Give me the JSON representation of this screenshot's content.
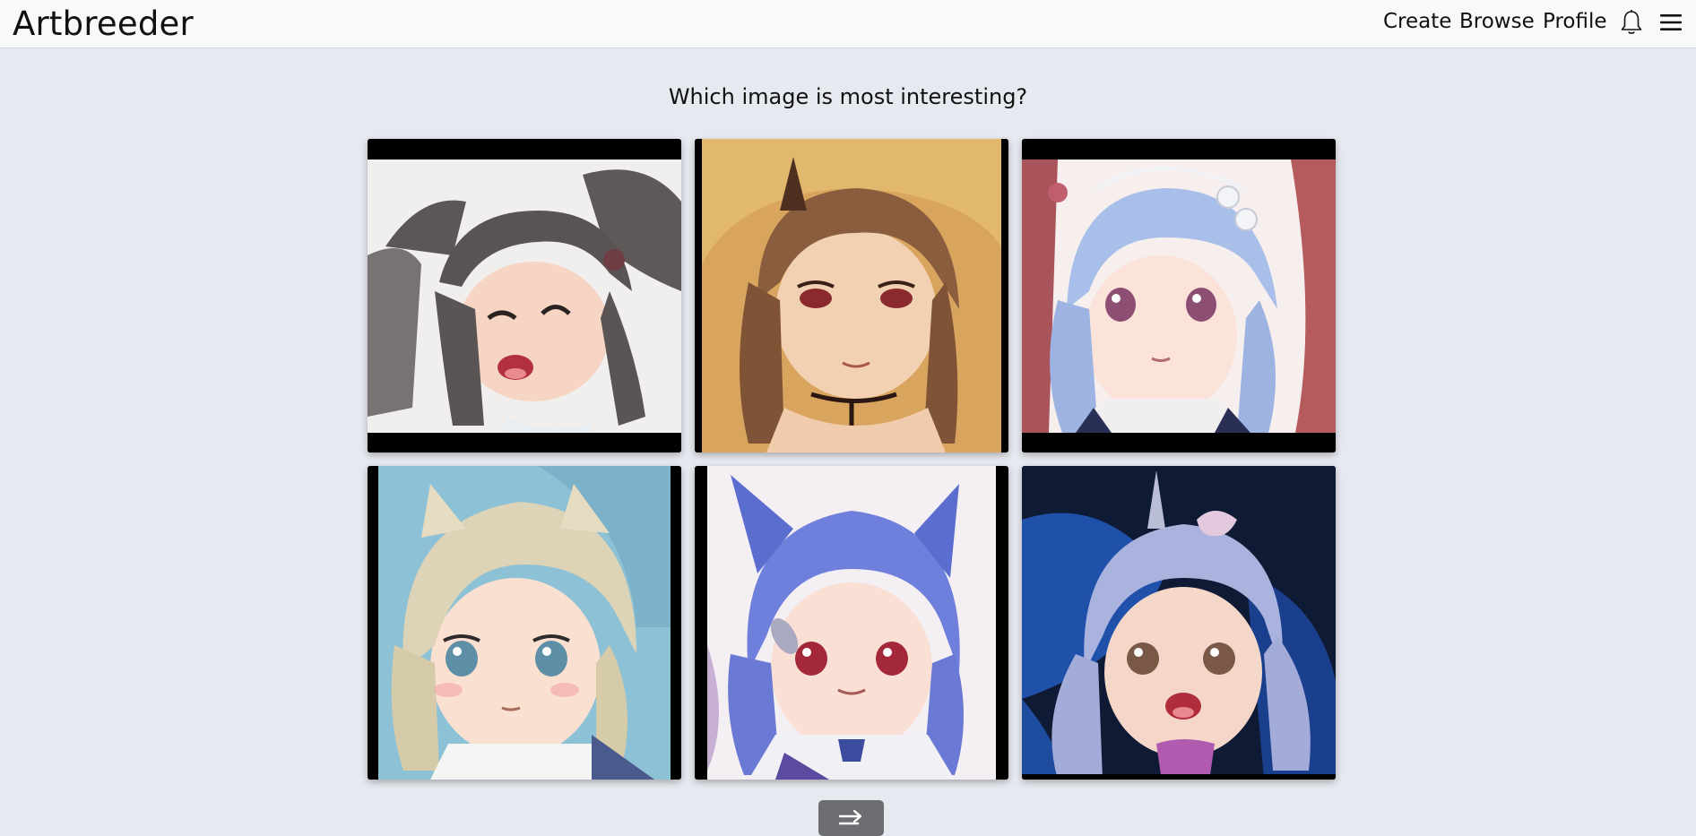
{
  "app": {
    "brand": "Artbreeder"
  },
  "nav": {
    "create": "Create",
    "browse": "Browse",
    "profile": "Profile",
    "icons": [
      "bell-icon",
      "hamburger-menu-icon"
    ]
  },
  "prompt": {
    "question": "Which image is most interesting?"
  },
  "choices": [
    {
      "subject": "anime girl with dark hair, winking and laughing",
      "palette": [
        "#585252",
        "#f2f0ee",
        "#f4cdb8"
      ]
    },
    {
      "subject": "anime girl with brown hair, smiling",
      "palette": [
        "#8a5a3b",
        "#e6b774",
        "#f2cdb0"
      ]
    },
    {
      "subject": "anime girl with light blue hair and maid headband",
      "palette": [
        "#a9c0ea",
        "#b4575a",
        "#fbe1da"
      ]
    },
    {
      "subject": "anime girl with blonde bob hair",
      "palette": [
        "#ddd3b4",
        "#8cc0d6",
        "#f9ddcd"
      ]
    },
    {
      "subject": "anime girl with blue hair and bow",
      "palette": [
        "#6f7fdc",
        "#f3eef2",
        "#f9ddd2"
      ]
    },
    {
      "subject": "anime girl with lavender hair and tiara",
      "palette": [
        "#aab2dc",
        "#1f4fa8",
        "#f4d5c8"
      ]
    }
  ],
  "actions": {
    "next_icon": "arrow-right-icon"
  }
}
